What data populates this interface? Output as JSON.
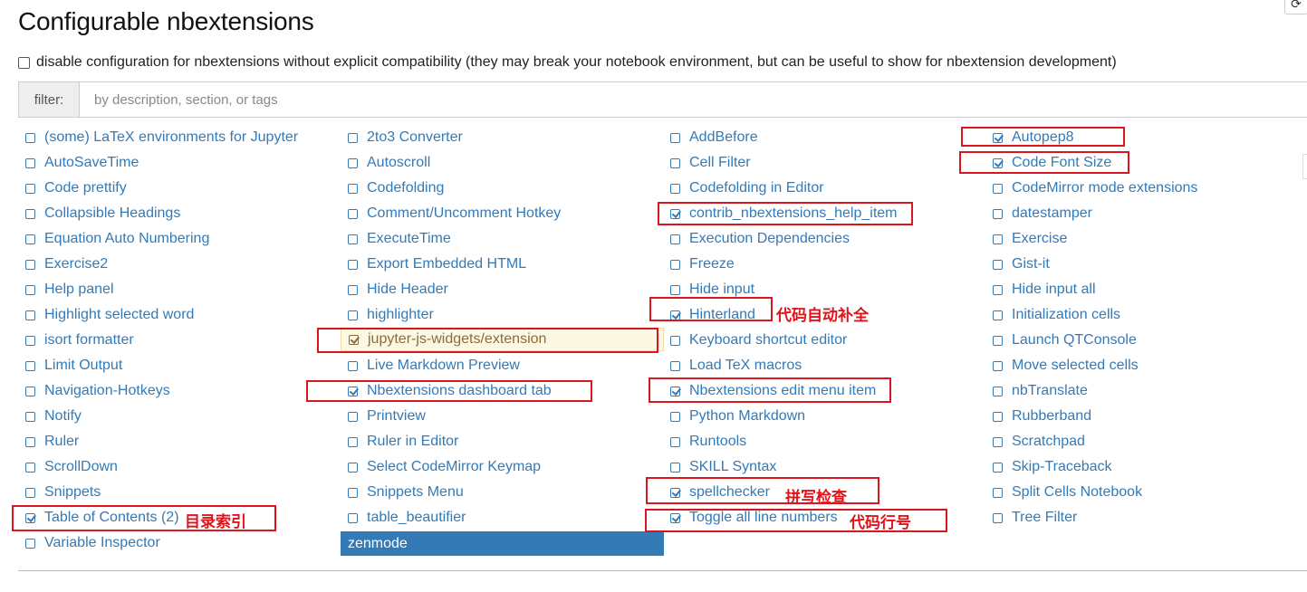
{
  "page": {
    "title": "Configurable nbextensions"
  },
  "compatibility": {
    "label": "disable configuration for nbextensions without explicit compatibility (they may break your notebook environment, but can be useful to show for nbextension development)"
  },
  "filter": {
    "label": "filter:",
    "placeholder": "by description, section, or tags"
  },
  "toolbar": {
    "refresh_glyph": "⟳"
  },
  "extensions": [
    [
      {
        "label": "(some) LaTeX environments for Jupyter",
        "checked": false
      },
      {
        "label": "AutoSaveTime",
        "checked": false
      },
      {
        "label": "Code prettify",
        "checked": false
      },
      {
        "label": "Collapsible Headings",
        "checked": false
      },
      {
        "label": "Equation Auto Numbering",
        "checked": false
      },
      {
        "label": "Exercise2",
        "checked": false
      },
      {
        "label": "Help panel",
        "checked": false
      },
      {
        "label": "Highlight selected word",
        "checked": false
      },
      {
        "label": "isort formatter",
        "checked": false
      },
      {
        "label": "Limit Output",
        "checked": false
      },
      {
        "label": "Navigation-Hotkeys",
        "checked": false
      },
      {
        "label": "Notify",
        "checked": false
      },
      {
        "label": "Ruler",
        "checked": false
      },
      {
        "label": "ScrollDown",
        "checked": false
      },
      {
        "label": "Snippets",
        "checked": false
      },
      {
        "label": "Table of Contents (2)",
        "checked": true
      },
      {
        "label": "Variable Inspector",
        "checked": false
      }
    ],
    [
      {
        "label": "2to3 Converter",
        "checked": false
      },
      {
        "label": "Autoscroll",
        "checked": false
      },
      {
        "label": "Codefolding",
        "checked": false
      },
      {
        "label": "Comment/Uncomment Hotkey",
        "checked": false
      },
      {
        "label": "ExecuteTime",
        "checked": false
      },
      {
        "label": "Export Embedded HTML",
        "checked": false
      },
      {
        "label": "Hide Header",
        "checked": false
      },
      {
        "label": "highlighter",
        "checked": false
      },
      {
        "label": "jupyter-js-widgets/extension",
        "checked": true,
        "state": "warning"
      },
      {
        "label": "Live Markdown Preview",
        "checked": false
      },
      {
        "label": "Nbextensions dashboard tab",
        "checked": true
      },
      {
        "label": "Printview",
        "checked": false
      },
      {
        "label": "Ruler in Editor",
        "checked": false
      },
      {
        "label": "Select CodeMirror Keymap",
        "checked": false
      },
      {
        "label": "Snippets Menu",
        "checked": false
      },
      {
        "label": "table_beautifier",
        "checked": false
      },
      {
        "label": "zenmode",
        "checked": false,
        "state": "selected"
      }
    ],
    [
      {
        "label": "AddBefore",
        "checked": false
      },
      {
        "label": "Cell Filter",
        "checked": false
      },
      {
        "label": "Codefolding in Editor",
        "checked": false
      },
      {
        "label": "contrib_nbextensions_help_item",
        "checked": true
      },
      {
        "label": "Execution Dependencies",
        "checked": false
      },
      {
        "label": "Freeze",
        "checked": false
      },
      {
        "label": "Hide input",
        "checked": false
      },
      {
        "label": "Hinterland",
        "checked": true
      },
      {
        "label": "Keyboard shortcut editor",
        "checked": false
      },
      {
        "label": "Load TeX macros",
        "checked": false
      },
      {
        "label": "Nbextensions edit menu item",
        "checked": true
      },
      {
        "label": "Python Markdown",
        "checked": false
      },
      {
        "label": "Runtools",
        "checked": false
      },
      {
        "label": "SKILL Syntax",
        "checked": false
      },
      {
        "label": "spellchecker",
        "checked": true
      },
      {
        "label": "Toggle all line numbers",
        "checked": true
      }
    ],
    [
      {
        "label": "Autopep8",
        "checked": true
      },
      {
        "label": "Code Font Size",
        "checked": true
      },
      {
        "label": "CodeMirror mode extensions",
        "checked": false
      },
      {
        "label": "datestamper",
        "checked": false
      },
      {
        "label": "Exercise",
        "checked": false
      },
      {
        "label": "Gist-it",
        "checked": false
      },
      {
        "label": "Hide input all",
        "checked": false
      },
      {
        "label": "Initialization cells",
        "checked": false
      },
      {
        "label": "Launch QTConsole",
        "checked": false
      },
      {
        "label": "Move selected cells",
        "checked": false
      },
      {
        "label": "nbTranslate",
        "checked": false
      },
      {
        "label": "Rubberband",
        "checked": false
      },
      {
        "label": "Scratchpad",
        "checked": false
      },
      {
        "label": "Skip-Traceback",
        "checked": false
      },
      {
        "label": "Split Cells Notebook",
        "checked": false
      },
      {
        "label": "Tree Filter",
        "checked": false
      }
    ]
  ],
  "annotations": {
    "hinterland": "代码自动补全",
    "spellchecker": "拼写检查",
    "toc": "目录索引",
    "line_numbers": "代码行号",
    "color": "#e3121a"
  }
}
